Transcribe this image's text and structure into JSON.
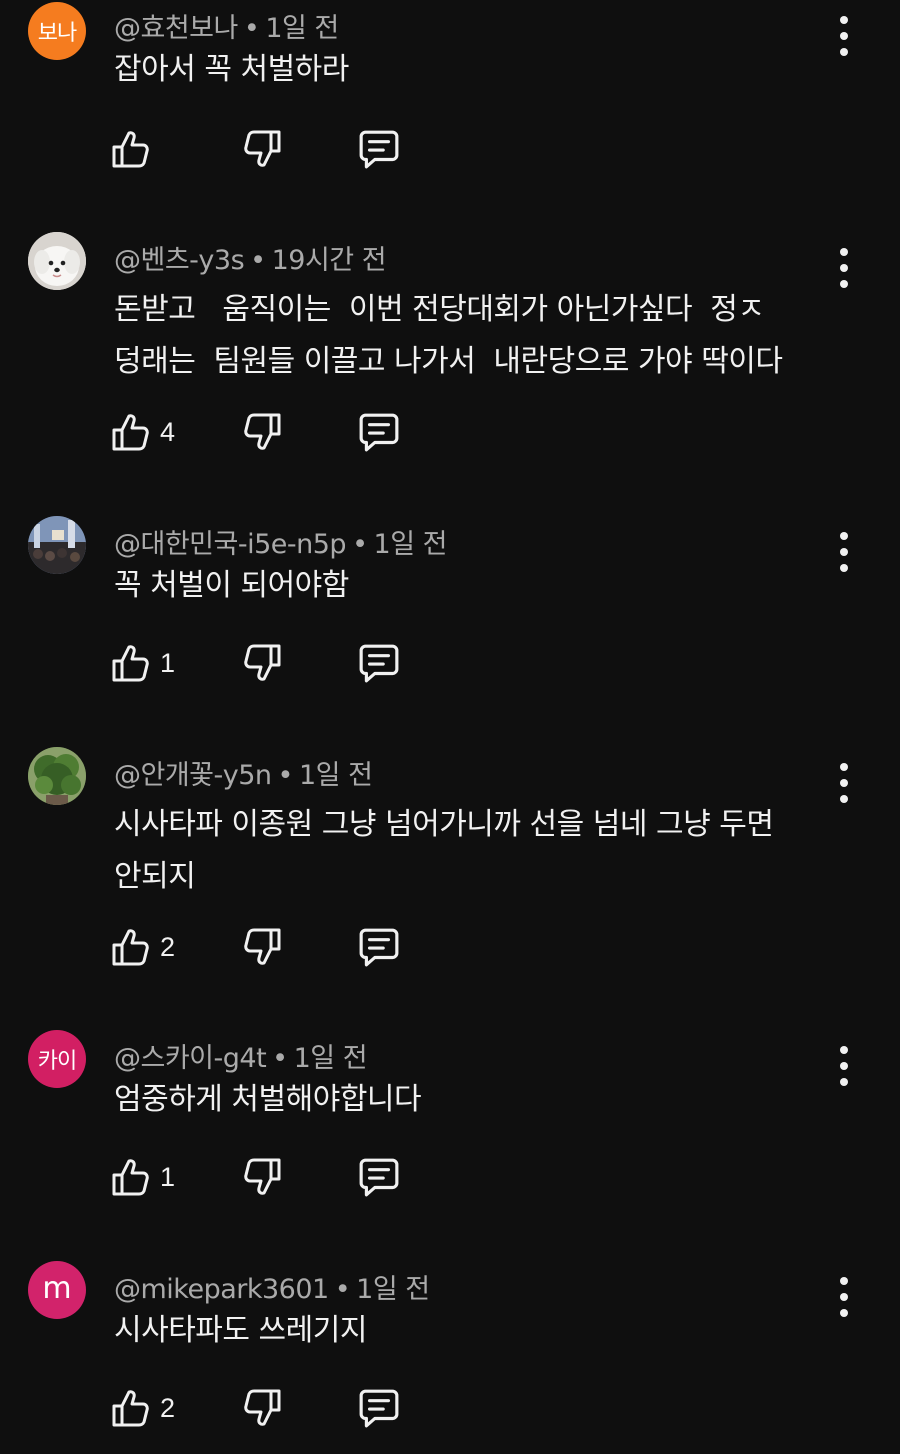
{
  "separator": "•",
  "colors": {
    "background": "#0f0f0f",
    "text_primary": "#f1f1f1",
    "text_secondary": "#aaaaaa",
    "avatar_orange": "#ff7a1a",
    "avatar_pink": "#d5206b"
  },
  "comments": [
    {
      "avatar": {
        "type": "text",
        "text": "보나",
        "color": "#f57c1f"
      },
      "author": "@효천보나",
      "time": "1일 전",
      "text": "잡아서 꼭 처벌하라",
      "likes": "",
      "icons": [
        "like-icon",
        "dislike-icon",
        "reply-icon",
        "more-vert-icon"
      ]
    },
    {
      "avatar": {
        "type": "image",
        "depicts": "white-puppy"
      },
      "author": "@벤츠-y3s",
      "time": "19시간 전",
      "text": "돈받고   움직이는  이번 전당대회가 아닌가싶다  정ㅈ\n덩래는  팀원들 이끌고 나가서  내란당으로 가야 딱이다",
      "likes": "4"
    },
    {
      "avatar": {
        "type": "image",
        "depicts": "crowd-photo"
      },
      "author": "@대한민국-i5e-n5p",
      "time": "1일 전",
      "text": "꼭 처벌이 되어야함",
      "likes": "1"
    },
    {
      "avatar": {
        "type": "image",
        "depicts": "green-plant"
      },
      "author": "@안개꽃-y5n",
      "time": "1일 전",
      "text": "시사타파 이종원 그냥 넘어가니까 선을 넘네 그냥 두면\n안되지",
      "likes": "2"
    },
    {
      "avatar": {
        "type": "text",
        "text": "카이",
        "color": "#d21f63"
      },
      "author": "@스카이-g4t",
      "time": "1일 전",
      "text": "엄중하게 처벌해야합니다",
      "likes": "1"
    },
    {
      "avatar": {
        "type": "letter",
        "text": "m",
        "color": "#d2236b"
      },
      "author": "@mikepark3601",
      "time": "1일 전",
      "text": "시사타파도 쓰레기지",
      "likes": "2"
    }
  ]
}
